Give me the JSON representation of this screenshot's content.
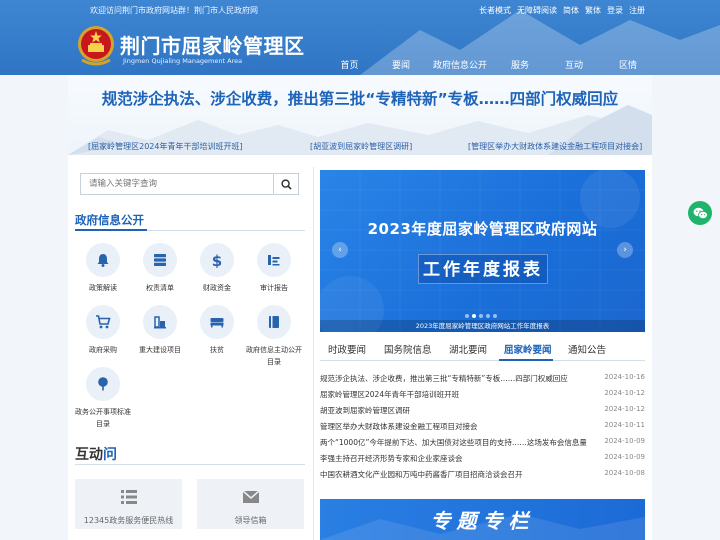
{
  "header": {
    "welcome": "欢迎访问荆门市政府网站群！荆门市人民政府网",
    "top_links": [
      "长者模式",
      "无障碍阅读",
      "简体",
      "繁体",
      "登录",
      "注册"
    ],
    "site_title": "荆门市屈家岭管理区",
    "site_subtitle": "Jingmen Qujialing Management Area",
    "nav": [
      "首页",
      "要闻",
      "政府信息公开",
      "服务",
      "互动",
      "区情"
    ]
  },
  "banner": {
    "headline": "规范涉企执法、涉企收费，推出第三批“专精特新”专板……四部门权威回应",
    "links": [
      "[屈家岭管理区2024年青年干部培训班开班]",
      "[胡亚波到屈家岭管理区调研]",
      "[管理区举办大财政体系建设金融工程项目对接会]"
    ]
  },
  "search": {
    "placeholder": "请输入关键字查询"
  },
  "gov_info": {
    "title": "政府信息公开",
    "items": [
      {
        "label": "政策解读",
        "icon": "bell-icon"
      },
      {
        "label": "权责清单",
        "icon": "server-icon"
      },
      {
        "label": "财政资金",
        "icon": "dollar-icon"
      },
      {
        "label": "审计报告",
        "icon": "report-icon"
      },
      {
        "label": "政府采购",
        "icon": "cart-icon"
      },
      {
        "label": "重大建设项目",
        "icon": "building-icon"
      },
      {
        "label": "扶贫",
        "icon": "bed-icon"
      },
      {
        "label": "政府信息主动公开目录",
        "icon": "book-icon"
      },
      {
        "label": "政务公开事项标准目录",
        "icon": "tree-icon"
      }
    ]
  },
  "interact": {
    "title_a": "互动",
    "title_b": "问",
    "items": [
      {
        "label": "12345政务服务便民热线",
        "icon": "list-icon"
      },
      {
        "label": "领导信箱",
        "icon": "mail-icon"
      }
    ]
  },
  "carousel": {
    "title": "2023年度屈家岭管理区政府网站",
    "report": "工作年度报表",
    "caption": "2023年度屈家岭管理区政府网站工作年度报表",
    "dot_count": 5,
    "active_dot": 1
  },
  "tabs": {
    "items": [
      "时政要闻",
      "国务院信息",
      "湖北要闻",
      "屈家岭要闻",
      "通知公告"
    ],
    "active": 3
  },
  "news": [
    {
      "title": "规范涉企执法、涉企收费，推出第三批“专精特新”专板……四部门权威回应",
      "date": "2024-10-16"
    },
    {
      "title": "屈家岭管理区2024年青年干部培训班开班",
      "date": "2024-10-12"
    },
    {
      "title": "胡亚波到屈家岭管理区调研",
      "date": "2024-10-12"
    },
    {
      "title": "管理区举办大财政体系建设金融工程项目对接会",
      "date": "2024-10-11"
    },
    {
      "title": "两个“1000亿”今年提前下达、加大国债对这些项目的支持……这场发布会信息量",
      "date": "2024-10-09"
    },
    {
      "title": "李强主持召开经济形势专家和企业家座谈会",
      "date": "2024-10-09"
    },
    {
      "title": "中国农耕酒文化产业园和万吨中药酱香厂项目招商洽谈会召开",
      "date": "2024-10-08"
    }
  ],
  "special": {
    "label": "专题专栏"
  },
  "colors": {
    "header_blue": "#3e86d2",
    "accent": "#1d63b8",
    "wechat_green": "#1fb36b"
  }
}
